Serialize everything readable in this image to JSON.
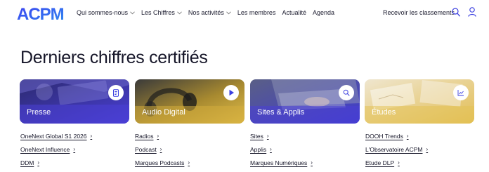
{
  "brand": {
    "logo_text": "ACPM",
    "color": "#3b3fe0"
  },
  "nav": {
    "items": [
      {
        "label": "Qui sommes-nous",
        "dropdown": true
      },
      {
        "label": "Les Chiffres",
        "dropdown": true
      },
      {
        "label": "Nos activités",
        "dropdown": true
      },
      {
        "label": "Les membres",
        "dropdown": false
      },
      {
        "label": "Actualité",
        "dropdown": false
      },
      {
        "label": "Agenda",
        "dropdown": false
      }
    ],
    "cta": "Recevoir les classements",
    "icons": [
      "search-icon",
      "user-icon"
    ]
  },
  "main": {
    "title": "Derniers chiffres certifiés",
    "cards": [
      {
        "label": "Presse",
        "icon": "document-icon",
        "tint": "#4a3fd6"
      },
      {
        "label": "Audio Digital",
        "icon": "play-icon",
        "tint": "#d9b43a"
      },
      {
        "label": "Sites & Applis",
        "icon": "search-icon",
        "tint": "#4a3fd6"
      },
      {
        "label": "Études",
        "icon": "chart-line-icon",
        "tint": "#e5c35a"
      }
    ],
    "columns": [
      [
        "OneNext Global S1 2026",
        "OneNext Influence",
        "DDM"
      ],
      [
        "Radios",
        "Podcast",
        "Marques Podcasts"
      ],
      [
        "Sites",
        "Applis",
        "Marques Numériques"
      ],
      [
        "DOOH Trends",
        "L'Observatoire ACPM",
        "Etude DLP"
      ]
    ],
    "arrow": "›"
  }
}
